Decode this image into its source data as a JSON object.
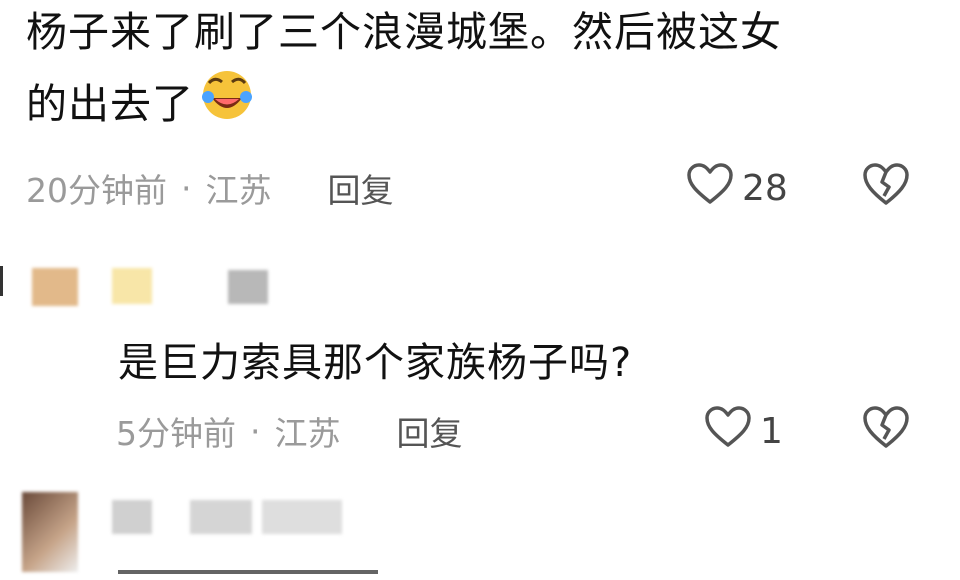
{
  "comment1": {
    "text_line1": "杨子来了刷了三个浪漫城堡。然后被这女",
    "text_line2": "的出去了",
    "emoji_icon": "laughing-crying-face-icon",
    "time": "20分钟前",
    "location": "江苏",
    "reply_label": "回复",
    "likes": "28"
  },
  "comment2": {
    "text": "是巨力索具那个家族杨子吗?",
    "time": "5分钟前",
    "location": "江苏",
    "reply_label": "回复",
    "likes": "1"
  },
  "comment3": {
    "text_partial": "—"
  }
}
